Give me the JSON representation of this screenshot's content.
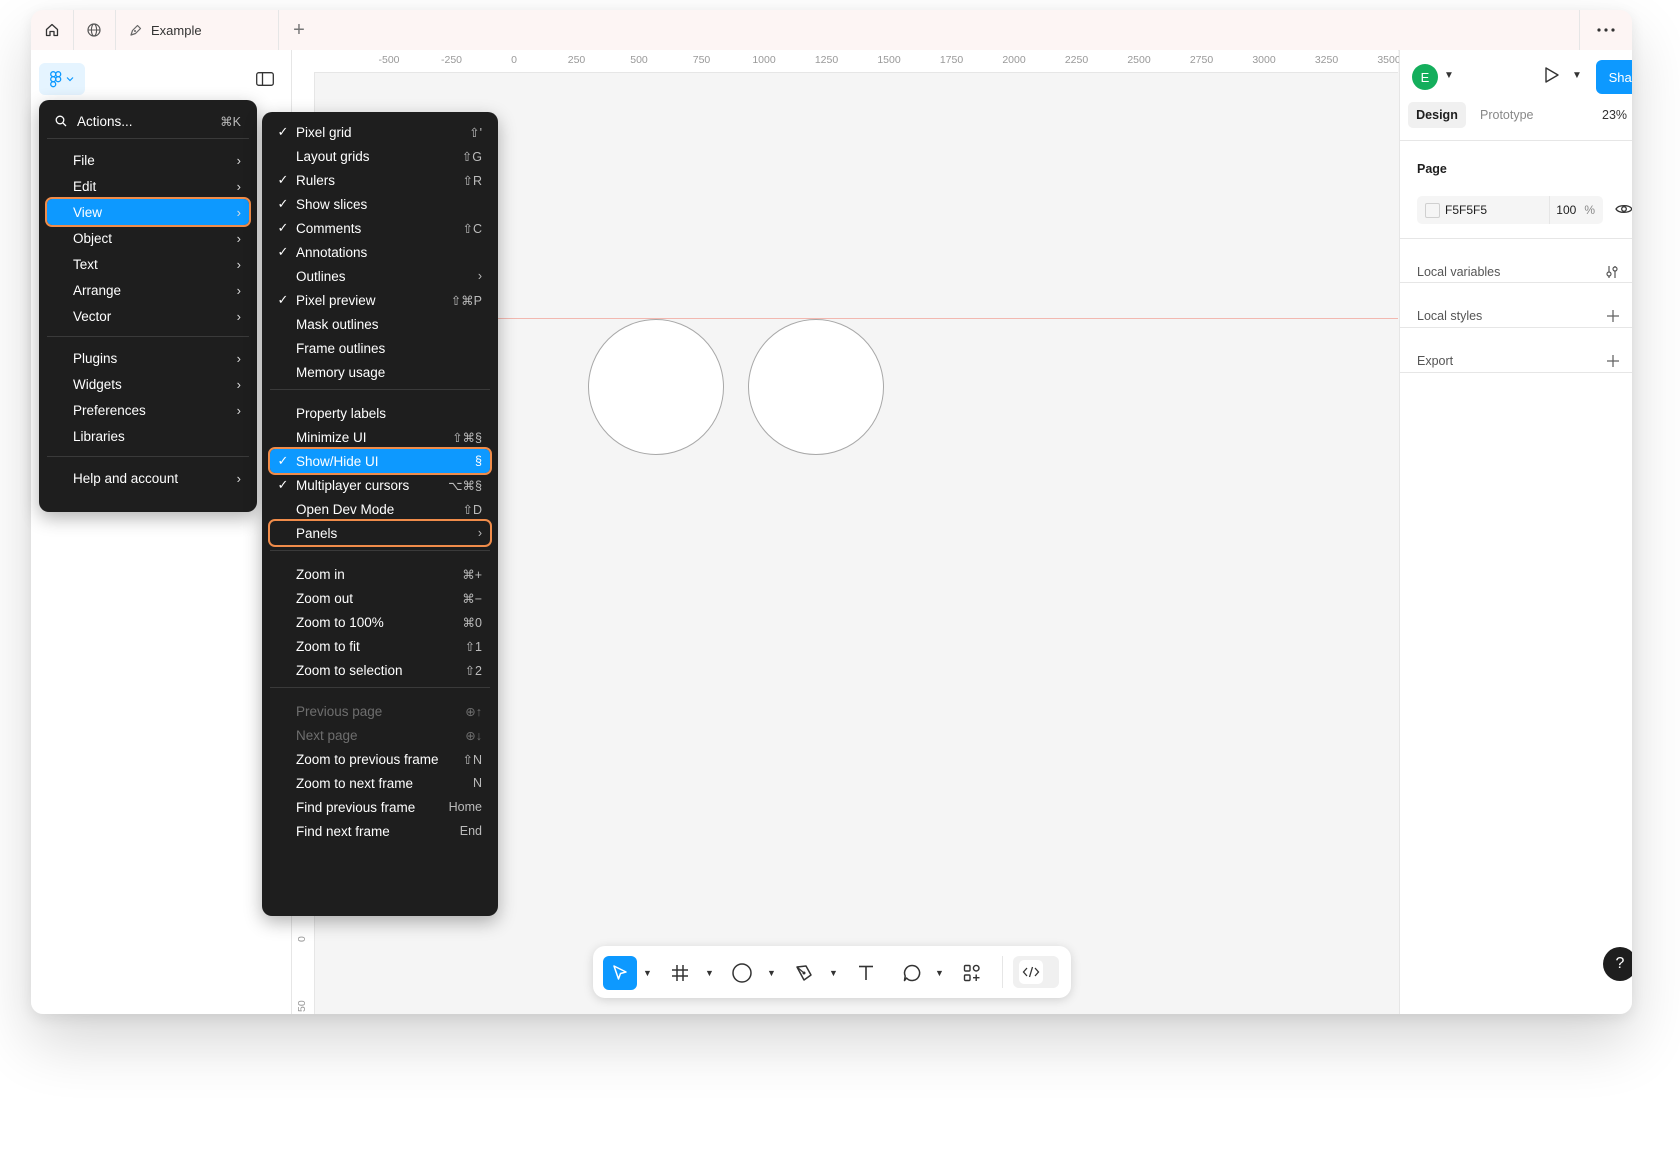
{
  "tabbar": {
    "file_name": "Example",
    "add_tab": "+",
    "more": "•••"
  },
  "ruler": {
    "top": [
      "-500",
      "-250",
      "0",
      "250",
      "500",
      "750",
      "1000",
      "1250",
      "1500",
      "1750",
      "2000",
      "2250",
      "2500",
      "2750",
      "3000",
      "3250",
      "3500"
    ],
    "left": [
      "0",
      "50"
    ]
  },
  "main_menu": {
    "actions_label": "Actions...",
    "actions_shortcut": "⌘K",
    "groups": [
      [
        "File",
        "Edit",
        "View",
        "Object",
        "Text",
        "Arrange",
        "Vector"
      ],
      [
        "Plugins",
        "Widgets",
        "Preferences",
        "Libraries"
      ],
      [
        "Help and account"
      ]
    ],
    "active_item": "View"
  },
  "view_menu": {
    "groups": [
      [
        {
          "label": "Pixel grid",
          "checked": true,
          "shortcut": "⇧'"
        },
        {
          "label": "Layout grids",
          "checked": false,
          "shortcut": "⇧G"
        },
        {
          "label": "Rulers",
          "checked": true,
          "shortcut": "⇧R"
        },
        {
          "label": "Show slices",
          "checked": true,
          "shortcut": ""
        },
        {
          "label": "Comments",
          "checked": true,
          "shortcut": "⇧C"
        },
        {
          "label": "Annotations",
          "checked": true,
          "shortcut": ""
        },
        {
          "label": "Outlines",
          "checked": false,
          "shortcut": "›"
        },
        {
          "label": "Pixel preview",
          "checked": true,
          "shortcut": "⇧⌘P"
        },
        {
          "label": "Mask outlines",
          "checked": false,
          "shortcut": ""
        },
        {
          "label": "Frame outlines",
          "checked": false,
          "shortcut": ""
        },
        {
          "label": "Memory usage",
          "checked": false,
          "shortcut": ""
        }
      ],
      [
        {
          "label": "Property labels",
          "checked": false,
          "shortcut": ""
        },
        {
          "label": "Minimize UI",
          "checked": false,
          "shortcut": "⇧⌘§"
        },
        {
          "label": "Show/Hide UI",
          "checked": true,
          "shortcut": "§",
          "highlighted": true
        },
        {
          "label": "Multiplayer cursors",
          "checked": true,
          "shortcut": "⌥⌘§"
        },
        {
          "label": "Open Dev Mode",
          "checked": false,
          "shortcut": "⇧D"
        },
        {
          "label": "Panels",
          "checked": false,
          "shortcut": "›",
          "outlined": true
        }
      ],
      [
        {
          "label": "Zoom in",
          "checked": false,
          "shortcut": "⌘+"
        },
        {
          "label": "Zoom out",
          "checked": false,
          "shortcut": "⌘−"
        },
        {
          "label": "Zoom to 100%",
          "checked": false,
          "shortcut": "⌘0"
        },
        {
          "label": "Zoom to fit",
          "checked": false,
          "shortcut": "⇧1"
        },
        {
          "label": "Zoom to selection",
          "checked": false,
          "shortcut": "⇧2"
        }
      ],
      [
        {
          "label": "Previous page",
          "checked": false,
          "shortcut": "⊕↑",
          "disabled": true
        },
        {
          "label": "Next page",
          "checked": false,
          "shortcut": "⊕↓",
          "disabled": true
        },
        {
          "label": "Zoom to previous frame",
          "checked": false,
          "shortcut": "⇧N"
        },
        {
          "label": "Zoom to next frame",
          "checked": false,
          "shortcut": "N"
        },
        {
          "label": "Find previous frame",
          "checked": false,
          "shortcut": "Home"
        },
        {
          "label": "Find next frame",
          "checked": false,
          "shortcut": "End"
        }
      ]
    ]
  },
  "right_panel": {
    "avatar_letter": "E",
    "share_label": "Share",
    "tabs": {
      "design": "Design",
      "prototype": "Prototype"
    },
    "zoom": "23%",
    "page_section": {
      "title": "Page",
      "color_hex": "F5F5F5",
      "opacity": "100",
      "opacity_unit": "%"
    },
    "local_variables": "Local variables",
    "local_styles": "Local styles",
    "export": "Export",
    "help": "?"
  },
  "colors": {
    "accent": "#0d99ff",
    "menu_bg": "#1e1e1e",
    "highlight_outline": "#f08c4a",
    "avatar": "#14ae5c",
    "canvas": "#f5f5f5"
  },
  "toolbar": {
    "tools": [
      "move-tool",
      "frame-tool",
      "shape-tool",
      "pen-tool",
      "text-tool",
      "comment-tool",
      "actions-tool",
      "dev-mode-toggle"
    ]
  }
}
